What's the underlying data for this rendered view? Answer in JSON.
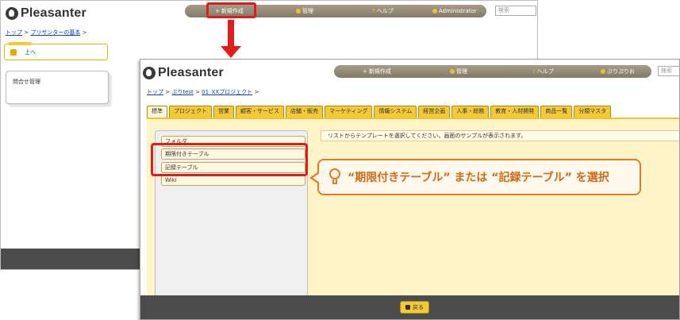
{
  "app": {
    "name": "Pleasanter"
  },
  "back_window": {
    "nav": [
      {
        "label": "新規作成",
        "icon": "plus-icon"
      },
      {
        "label": "管理",
        "icon": "gear-icon"
      },
      {
        "label": "ヘルプ",
        "icon": "question-icon"
      },
      {
        "label": "Administrator",
        "icon": "user-icon"
      }
    ],
    "search_placeholder": "検索",
    "breadcrumb": {
      "home": "トップ",
      "sep": ">",
      "site": "プリザンターの基本",
      "trail": ">"
    },
    "up_button": "上へ",
    "card_title": "問合せ管理"
  },
  "front_window": {
    "nav": [
      {
        "label": "新規作成",
        "icon": "plus-icon"
      },
      {
        "label": "管理",
        "icon": "gear-icon"
      },
      {
        "label": "ヘルプ",
        "icon": "question-icon"
      },
      {
        "label": "ぷりぷりお",
        "icon": "user-icon"
      }
    ],
    "search_placeholder": "検索",
    "breadcrumb": {
      "home": "トップ",
      "sep1": ">",
      "site": "ぷりtest",
      "sep2": ">",
      "project": "01_XXプロジェクト",
      "trail": ">"
    },
    "tabs": [
      "標準",
      "プロジェクト",
      "営業",
      "顧客・サービス",
      "店舗・販売",
      "マーケティング",
      "情報システム",
      "経営企画",
      "人事・総務",
      "教育・人材開発",
      "商品一覧",
      "分類マスタ"
    ],
    "tree": [
      "フォルダ",
      "期限付きテーブル",
      "記録テーブル",
      "Wiki"
    ],
    "message": "リストからテンプレートを選択してください。画面のサンプルが表示されます。",
    "back_button": "戻る"
  },
  "callout": "“期限付きテーブル” または “記録テーブル” を選択",
  "colors": {
    "accent": "#f3c93a",
    "highlight": "#e21b1b",
    "callout": "#e47a22",
    "footer": "#4c4c4c"
  }
}
